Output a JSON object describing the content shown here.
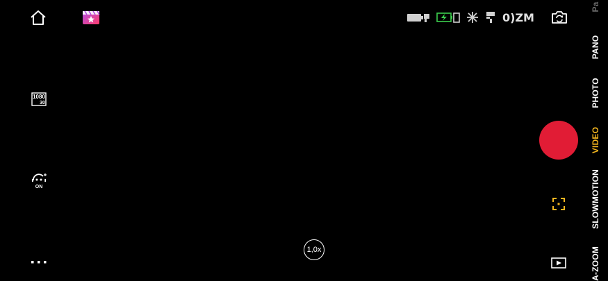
{
  "top_bar": {
    "status_text": "0)ZM"
  },
  "zoom": {
    "label": "1,0x"
  },
  "left_tools": {
    "resolution_top": "1080",
    "resolution_bottom": "30",
    "stabilizer_state": "ON"
  },
  "modes": {
    "items": [
      {
        "label": "Pa",
        "state": "dim"
      },
      {
        "label": "PANO",
        "state": "normal"
      },
      {
        "label": "PHOTO",
        "state": "normal"
      },
      {
        "label": "VIDEO",
        "state": "active"
      },
      {
        "label": "SLOWMOTION",
        "state": "normal"
      },
      {
        "label": "A-ZOOM",
        "state": "normal"
      }
    ]
  },
  "colors": {
    "record": "#e11c35",
    "active_mode": "#f3b51f",
    "battery_green": "#3ccf4e"
  }
}
